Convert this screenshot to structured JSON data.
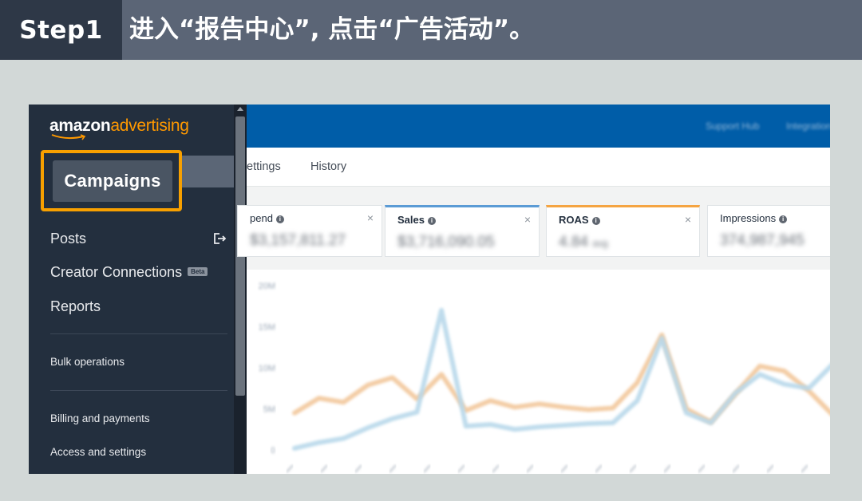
{
  "banner": {
    "step": "Step1",
    "instruction": "进入“报告中心”, 点击“广告活动”。"
  },
  "sidebar": {
    "logo": {
      "word1": "amazon",
      "word2": "advertising"
    },
    "highlighted_button": "Campaigns",
    "items": [
      {
        "label": "Posts"
      },
      {
        "label": "Creator Connections",
        "badge": "Beta"
      },
      {
        "label": "Reports"
      }
    ],
    "secondary": [
      {
        "label": "Bulk operations"
      },
      {
        "label": "Billing and payments"
      },
      {
        "label": "Access and settings"
      }
    ]
  },
  "topbar": {
    "links": [
      "Support Hub",
      "Integration"
    ]
  },
  "tabs": [
    {
      "label": "ettings"
    },
    {
      "label": "History"
    }
  ],
  "metrics": [
    {
      "label": "pend",
      "value": "$3,157,811.27"
    },
    {
      "label": "Sales",
      "value": "$3,716,090.05",
      "accent": "#5b9bd5"
    },
    {
      "label": "ROAS",
      "value": "4.84",
      "unit": "avg",
      "accent": "#f5a442"
    },
    {
      "label": "Impressions",
      "value": "374,987,945"
    }
  ],
  "chart_data": {
    "type": "line",
    "ylabels": [
      "20M",
      "15M",
      "10M",
      "5M",
      "0"
    ],
    "series": [
      {
        "color": "#f2c79b",
        "values": [
          4.5,
          6.3,
          5.8,
          7.9,
          8.8,
          6.2,
          9.2,
          4.8,
          6.0,
          5.2,
          5.6,
          5.2,
          4.9,
          5.1,
          8.2,
          14.0,
          5.0,
          3.4,
          6.8,
          10.2,
          9.6,
          7.2,
          4.2
        ]
      },
      {
        "color": "#b8d8ea",
        "values": [
          0.2,
          0.9,
          1.4,
          2.7,
          3.8,
          4.6,
          17.0,
          2.9,
          3.1,
          2.5,
          2.8,
          3.0,
          3.2,
          3.3,
          6.0,
          13.6,
          4.5,
          3.3,
          6.9,
          9.2,
          8.0,
          7.5,
          10.5
        ]
      }
    ]
  },
  "colors": {
    "banner": "#5b6576",
    "step_box": "#2e3847",
    "sidebar": "#232f3e",
    "topbar": "#005da8",
    "highlight": "#f7a000",
    "logo_accent": "#ff9900"
  }
}
